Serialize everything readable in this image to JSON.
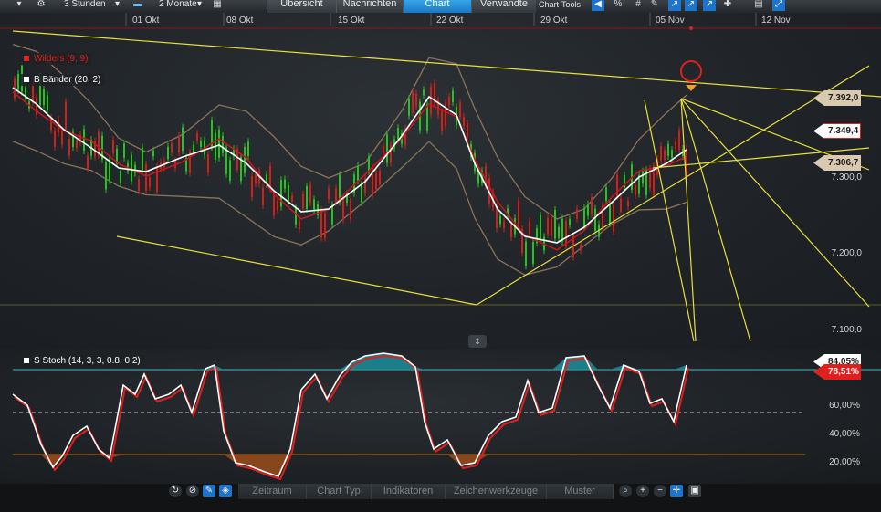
{
  "toolbar": {
    "interval": "3 Stunden",
    "range": "2 Monate",
    "tabs": [
      "Übersicht",
      "Nachrichten",
      "Chart",
      "Verwandte"
    ],
    "active_tab": "Chart",
    "chart_tools": "Chart-Tools"
  },
  "main_chart": {
    "x_labels": [
      "01 Okt",
      "08 Okt",
      "15 Okt",
      "22 Okt",
      "29 Okt",
      "05 Nov",
      "12 Nov"
    ],
    "y_labels": [
      "7.300,0",
      "7.200,0",
      "7.100,0"
    ],
    "legend": [
      {
        "label": "Wilders (9, 9)",
        "color": "#e0201c"
      },
      {
        "label": "B Bänder (20, 2)",
        "color": "#ffffff"
      }
    ],
    "price_tags": [
      {
        "label": "7.392,0",
        "bg": "#d9c9b0",
        "color": "#1a1a1a"
      },
      {
        "label": "7.349,4",
        "bg": "#ffffff",
        "color": "#1a1a1a",
        "border": "#e0201c"
      },
      {
        "label": "7.306,7",
        "bg": "#d9c9b0",
        "color": "#1a1a1a"
      }
    ]
  },
  "stoch_chart": {
    "legend": "S Stoch (14, 3, 3, 0.8, 0.2)",
    "y_labels": [
      "60,00%",
      "40,00%",
      "20,00%"
    ],
    "tags": [
      {
        "label": "84,05%",
        "bg": "#ffffff",
        "color": "#1a1a1a"
      },
      {
        "label": "78,51%",
        "bg": "#e0201c",
        "color": "#ffffff"
      }
    ]
  },
  "bottombar": {
    "buttons": [
      "Zeitraum",
      "Chart Typ",
      "Indikatoren",
      "Zeichenwerkzeuge",
      "Muster"
    ]
  },
  "icons": {
    "gear": "gear-icon",
    "calendar": "calendar-icon",
    "back": "back-arrow-icon",
    "percent": "percent-icon",
    "grid": "grid-icon",
    "print": "print-icon",
    "reset": "reset-icon"
  },
  "colors": {
    "up_candle": "#21c421",
    "down_candle": "#d1201c",
    "wilders": "#c8161b",
    "bollinger": "#8a7358",
    "middle_band": "#ffffff",
    "trendline": "#e8e03a",
    "stoch_k": "#ffffff",
    "stoch_d": "#e0201c",
    "overbought_fill": "#1a8e9a",
    "oversold_fill": "#9a4e1a"
  }
}
